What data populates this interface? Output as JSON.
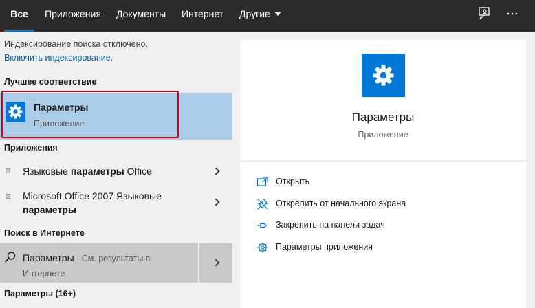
{
  "tabs": {
    "all": "Все",
    "apps": "Приложения",
    "documents": "Документы",
    "internet": "Интернет",
    "other": "Другие"
  },
  "topbar_icons": [
    "feedback-icon",
    "more-icon"
  ],
  "indexing": {
    "notice": "Индексирование поиска отключено.",
    "link": "Включить индексирование."
  },
  "best_match": {
    "heading": "Лучшее соответствие",
    "title": "Параметры",
    "subtitle": "Приложение",
    "icon": "gear-icon",
    "color": "#0078d7"
  },
  "apps_section": {
    "heading": "Приложения",
    "items": [
      {
        "text_pre": "Языковые ",
        "text_bold": "параметры",
        "text_post": " Office"
      },
      {
        "text_pre": "Microsoft Office 2007 Языковые ",
        "text_bold": "параметры",
        "text_post": ""
      }
    ]
  },
  "web_section": {
    "heading": "Поиск в Интернете",
    "query": "Параметры",
    "hint": " - См. результаты в Интернете"
  },
  "settings_count": "Параметры (16+)",
  "preview": {
    "title": "Параметры",
    "subtitle": "Приложение",
    "icon": "gear-icon"
  },
  "actions": [
    {
      "label": "Открыть",
      "icon": "open-icon"
    },
    {
      "label": "Открепить от начального экрана",
      "icon": "unpin-icon"
    },
    {
      "label": "Закрепить на панели задач",
      "icon": "pin-icon"
    },
    {
      "label": "Параметры приложения",
      "icon": "gear-icon"
    }
  ],
  "colors": {
    "accent": "#0078d7",
    "selection": "#accde8",
    "highlight_outline": "#d6001c",
    "topbar": "#2b2b2b"
  }
}
